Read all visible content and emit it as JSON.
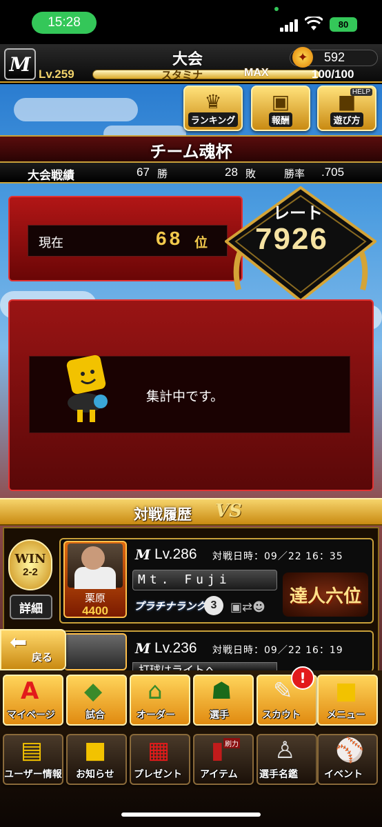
{
  "status_bar": {
    "time": "15:28",
    "battery": "80"
  },
  "header": {
    "logo": "M",
    "title": "大会",
    "coins": "592",
    "level": "Lv.259",
    "stamina_label": "スタミナ",
    "stamina_max": "MAX",
    "stamina_value": "100/100",
    "stamina_fill": 1.0
  },
  "top_buttons": {
    "ranking": "ランキング",
    "reward": "報酬",
    "howto": "遊び方",
    "help_tag": "HELP"
  },
  "cup": {
    "title": "チーム魂杯",
    "record_label": "大会戦績",
    "wins": "67",
    "wins_unit": "勝",
    "losses": "28",
    "losses_unit": "敗",
    "win_rate_label": "勝率",
    "win_rate": ".705"
  },
  "rank": {
    "label": "現在",
    "position": "68",
    "unit": "位",
    "rate_label": "レート",
    "rate_value": "7926"
  },
  "status_message": "集計中です。",
  "history": {
    "title": "対戦履歴",
    "vs": "VS",
    "win_badge": "WIN",
    "score": "2-2",
    "detail_button": "詳細",
    "player_name": "栗原",
    "player_score": "4400",
    "matches": [
      {
        "logo": "M",
        "level": "Lv.286",
        "date": "対戦日時：09／22 16：35",
        "opponent": "Mt. Fuji",
        "rank": "プラチナランク",
        "rank_num": "3",
        "title_badge": "達人六位"
      },
      {
        "logo": "M",
        "level": "Lv.236",
        "date": "対戦日時：09／22 16：19",
        "opponent": "打球はライトへ"
      }
    ]
  },
  "back_button": "戻る",
  "nav_row1": [
    "マイページ",
    "試合",
    "オーダー",
    "選手",
    "スカウト",
    "メニュー"
  ],
  "nav_row2": [
    "ユーザー情報",
    "お知らせ",
    "プレゼント",
    "アイテム",
    "選手名鑑",
    "イベント"
  ],
  "scout_alert": "!",
  "item_tag": "刷力"
}
